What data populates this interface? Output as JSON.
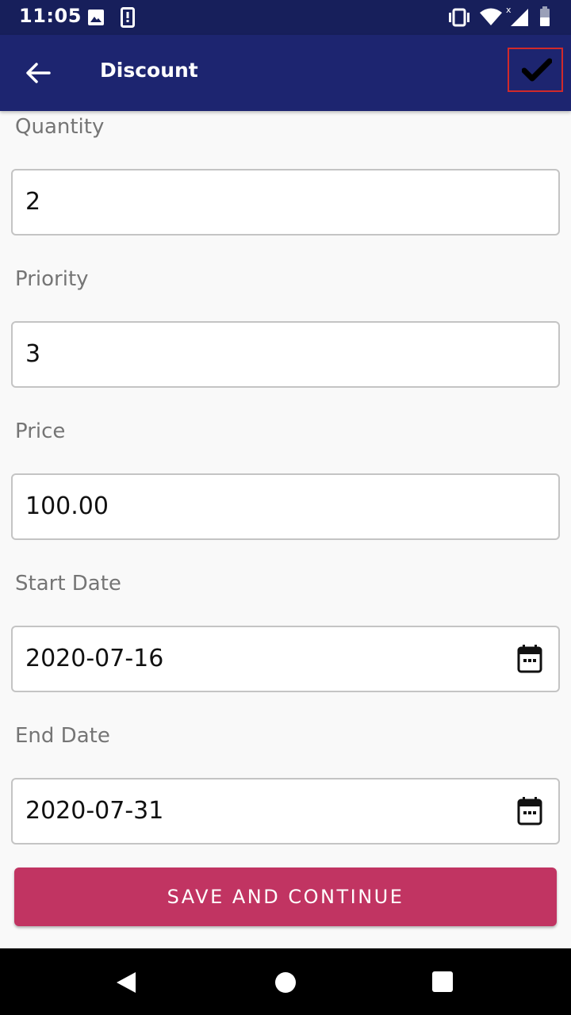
{
  "status_bar": {
    "time": "11:05"
  },
  "app_bar": {
    "title": "Discount"
  },
  "form": {
    "quantity": {
      "label": "Quantity",
      "value": "2"
    },
    "priority": {
      "label": "Priority",
      "value": "3"
    },
    "price": {
      "label": "Price",
      "value": "100.00"
    },
    "start_date": {
      "label": "Start Date",
      "value": "2020-07-16"
    },
    "end_date": {
      "label": "End Date",
      "value": "2020-07-31"
    }
  },
  "save_button": {
    "label": "SAVE AND CONTINUE"
  },
  "colors": {
    "status_bar": "#171f5b",
    "app_bar": "#1d2570",
    "save_button": "#c13462",
    "highlight_border": "#d12a2a"
  },
  "icons": [
    "image-icon",
    "phone-alert-icon",
    "vibrate-icon",
    "wifi-icon",
    "signal-icon",
    "battery-icon",
    "back-arrow-icon",
    "check-icon",
    "calendar-icon",
    "nav-back-icon",
    "nav-home-icon",
    "nav-recents-icon"
  ]
}
